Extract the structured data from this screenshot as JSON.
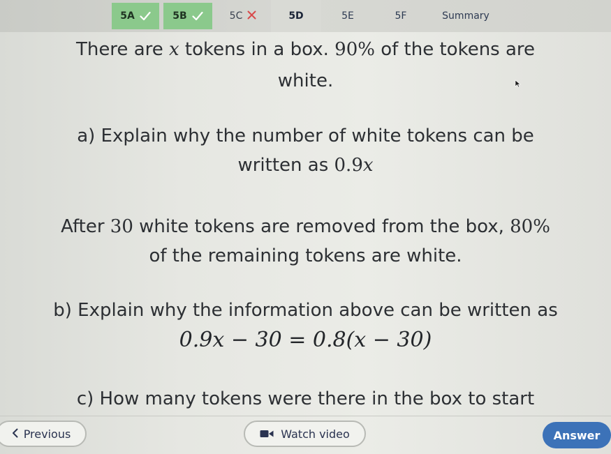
{
  "tabs": [
    {
      "label": "5A",
      "status": "correct"
    },
    {
      "label": "5B",
      "status": "correct"
    },
    {
      "label": "5C",
      "status": "incorrect"
    },
    {
      "label": "5D",
      "status": "active"
    },
    {
      "label": "5E",
      "status": "none"
    },
    {
      "label": "5F",
      "status": "none"
    },
    {
      "label": "Summary",
      "status": "none"
    }
  ],
  "question": {
    "intro_line1_a": "There are ",
    "intro_var": "x",
    "intro_line1_b": " tokens in a box. ",
    "intro_pct": "90%",
    "intro_line1_c": " of the tokens are",
    "intro_line2": "white.",
    "part_a_line1": "a) Explain why the number of white tokens can be",
    "part_a_line2": "written as ",
    "part_a_expr_num": "0.9",
    "part_a_expr_var": "x",
    "after_line1_a": "After ",
    "after_num": "30",
    "after_line1_b": " white tokens are removed from the box, ",
    "after_pct": "80%",
    "after_line2": "of the remaining tokens are white.",
    "part_b_line1": "b) Explain why the information above can be written as",
    "equation": "0.9x − 30 = 0.8(x − 30)",
    "part_c_line1": "c) How many tokens were there in the box to start"
  },
  "footer": {
    "previous_label": "Previous",
    "watch_video_label": "Watch video",
    "answer_label": "Answer"
  },
  "colors": {
    "correct_tab": "#8bc98c",
    "incorrect_mark": "#d84a4a",
    "answer_button": "#3c72b8"
  }
}
